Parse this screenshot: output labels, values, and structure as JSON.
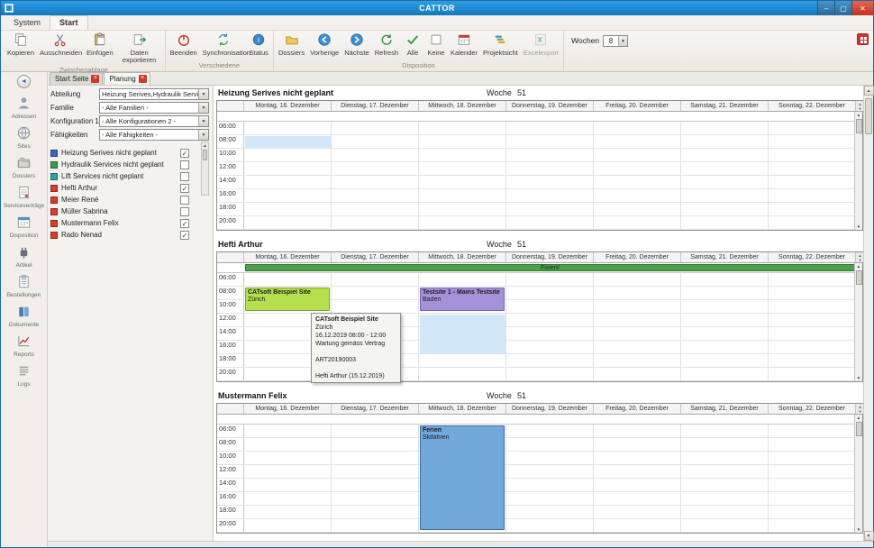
{
  "window": {
    "title": "CATTOR",
    "controls": {
      "minimize": "–",
      "maximize": "▢",
      "close": "✕"
    }
  },
  "menubar": {
    "items": [
      "System",
      "Start"
    ]
  },
  "ribbon": {
    "groups": [
      {
        "label": "Zwischenablage",
        "buttons": [
          "Kopieren",
          "Ausschneiden",
          "Einfügen",
          "Daten exportieren"
        ]
      },
      {
        "label": "Verschiedene",
        "buttons": [
          "Beenden",
          "Synchronisation",
          "Status"
        ]
      },
      {
        "label": "Disposition",
        "buttons": [
          "Dossiers",
          "Vorherige",
          "Nächste",
          "Refresh",
          "Alle",
          "Keine",
          "Kalender",
          "Projektsicht",
          "Excelexport"
        ]
      }
    ],
    "wochen": {
      "label": "Wochen",
      "value": "8"
    }
  },
  "sidebar": {
    "items": [
      "Adressen",
      "Sites",
      "Dossiers",
      "Serviceverträge",
      "Disposition",
      "Artikel",
      "Bestellungen",
      "Dokumente",
      "Reports",
      "Logs"
    ]
  },
  "tabs": {
    "items": [
      {
        "label": "Start Seite"
      },
      {
        "label": "Planung"
      }
    ]
  },
  "filters": {
    "fields": [
      {
        "label": "Abteilung",
        "value": "Heizung Serives,Hydraulik Services,..."
      },
      {
        "label": "Familie",
        "value": "- Alle Familien -"
      },
      {
        "label": "Konfiguration 1",
        "value": "- Alle Konfigurationen 2 -"
      },
      {
        "label": "Fähigkeiten",
        "value": "- Alle Fähigkeiten -"
      }
    ],
    "resources": [
      {
        "label": "Heizung Serives nicht geplant",
        "color": "#3a66c8",
        "checked": true
      },
      {
        "label": "Hydraulik Services nicht geplant",
        "color": "#3a9e4a",
        "checked": false
      },
      {
        "label": "Lift Services nicht geplant",
        "color": "#28a8a8",
        "checked": false
      },
      {
        "label": "Hefti Arthur",
        "color": "#dd3b2c",
        "checked": true
      },
      {
        "label": "Meier René",
        "color": "#dd3b2c",
        "checked": false
      },
      {
        "label": "Müller Sabrina",
        "color": "#dd3b2c",
        "checked": false
      },
      {
        "label": "Mustermann Felix",
        "color": "#dd3b2c",
        "checked": true
      },
      {
        "label": "Rado Nenad",
        "color": "#dd3b2c",
        "checked": true
      }
    ]
  },
  "calendar": {
    "week_label": "Woche",
    "week_number": "51",
    "days": [
      "Montag, 16. Dezember",
      "Dienstag, 17. Dezember",
      "Mittwoch, 18. Dezember",
      "Donnerstag, 19. Dezember",
      "Freitag, 20. Dezember",
      "Samstag, 21. Dezember",
      "Sonntag, 22. Dezember"
    ],
    "times": [
      "06:00",
      "08:00",
      "10:00",
      "12:00",
      "14:00",
      "16:00",
      "18:00",
      "20:00"
    ],
    "sections": [
      {
        "title": "Heizung Serives nicht geplant",
        "highlights": [
          {
            "day": 0,
            "row": 1,
            "rows": 1
          }
        ],
        "events": []
      },
      {
        "title": "Hefti Arthur",
        "allday": {
          "label": "Fixiert/",
          "bg": "#4ea04e",
          "border": "#2f7a2f"
        },
        "highlights": [
          {
            "day": 2,
            "row": 3,
            "rows": 3
          }
        ],
        "events": [
          {
            "day": 0,
            "row": 1,
            "rows": 2,
            "title": "CATsoft Beispiel Site",
            "subtitle": "Zürich",
            "bg": "#b5e04e",
            "border": "#79a928"
          },
          {
            "day": 2,
            "row": 1,
            "rows": 2,
            "title": "Testsite 1 - Mains Testsite",
            "subtitle": "Baden",
            "bg": "#a392d8",
            "border": "#7a66bd"
          }
        ]
      },
      {
        "title": "Mustermann Felix",
        "highlights": [],
        "events": [
          {
            "day": 2,
            "row": 0,
            "rows": 8,
            "title": "Ferien",
            "subtitle": "Skifahren",
            "bg": "#72a8dc",
            "border": "#3a6ea8"
          }
        ]
      }
    ],
    "tooltip": {
      "title": "CATsoft Beispiel Site",
      "lines": [
        "Zürich",
        "16.12.2019 08:00 - 12:00",
        "Wartung gemäss Vertrag",
        "",
        "ART20190003",
        "",
        "Hefti Arthur (15.12.2019)"
      ]
    }
  }
}
